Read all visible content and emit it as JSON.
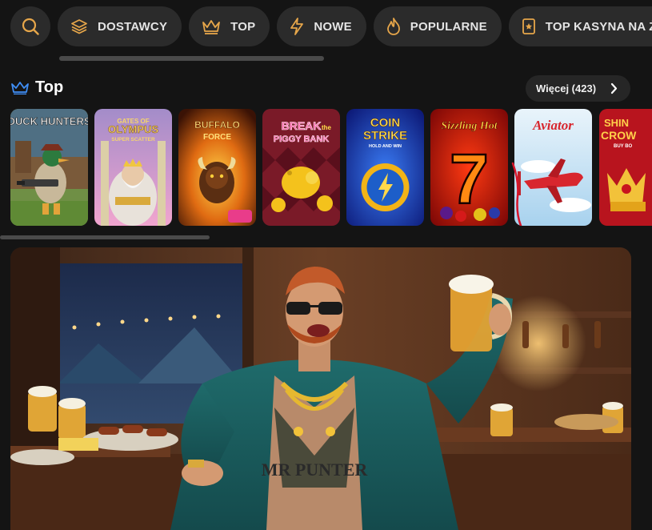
{
  "categories": [
    {
      "label": "DOSTAWCY",
      "icon": "layers-icon"
    },
    {
      "label": "TOP",
      "icon": "crown-icon"
    },
    {
      "label": "NOWE",
      "icon": "lightning-icon"
    },
    {
      "label": "POPULARNE",
      "icon": "flame-icon"
    },
    {
      "label": "TOP KASYNA NA ŻY",
      "icon": "badge-icon"
    }
  ],
  "section": {
    "title": "Top",
    "more_label": "Więcej (423)"
  },
  "games": [
    {
      "title": "Duck Hunters"
    },
    {
      "title": "Gates of Olympus Super Scatter"
    },
    {
      "title": "Buffalo Force"
    },
    {
      "title": "Break the Piggy Bank"
    },
    {
      "title": "Coin Strike Hold and Win"
    },
    {
      "title": "Sizzling Hot"
    },
    {
      "title": "Aviator"
    },
    {
      "title": "Shining Crown"
    }
  ],
  "tile_text": {
    "duck": "DUCK HUNTERS",
    "olympus_top": "GATES OF",
    "olympus_mid": "OLYMPUS",
    "olympus_bot": "SUPER SCATTER",
    "buffalo_top": "BUFFALO",
    "buffalo_bot": "FORCE",
    "piggy_top": "BREAK",
    "piggy_the": "the",
    "piggy_bot": "PIGGY BANK",
    "coin_top": "COIN",
    "coin_mid": "STRIKE",
    "coin_bot": "HOLD AND WIN",
    "sizzling": "Sizzling Hot",
    "seven": "7",
    "aviator": "Aviator",
    "crown_top": "SHIN",
    "crown_mid": "CROW",
    "crown_bot": "BUY BO"
  },
  "banner": {
    "chest_text": "MR PUNTER"
  },
  "colors": {
    "background": "#141414",
    "pill": "#2b2b2b",
    "accent_blue": "#3f8ef5"
  }
}
